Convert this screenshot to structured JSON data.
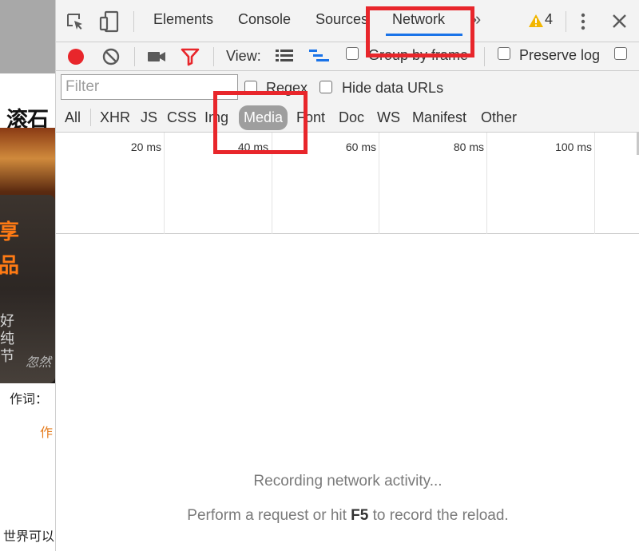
{
  "webpage": {
    "logo_text": "滚石",
    "art_orange_lines": [
      "享",
      "品"
    ],
    "art_gray_lines": [
      "好",
      "纯",
      "节"
    ],
    "art_small_text": "忽然",
    "lyric_1": "作词：",
    "lyric_2": "作",
    "lyric_3": "世界可以"
  },
  "devtools": {
    "tabs": {
      "elements": "Elements",
      "console": "Console",
      "sources": "Sources",
      "network": "Network"
    },
    "overflow_icon": "»",
    "warning_count": "4",
    "icons": {
      "inspect": "inspect-element-icon",
      "device": "device-toolbar-icon",
      "warning": "warning-icon",
      "more": "more-vertical-icon",
      "close": "close-icon",
      "record": "record-icon",
      "clear": "clear-icon",
      "capture": "screenshot-camera-icon",
      "filter": "filter-icon",
      "large_rows": "large-rows-icon",
      "waterfall": "waterfall-icon"
    },
    "toolbar": {
      "view_label": "View:",
      "group_by_frame": "Group by frame",
      "preserve_log": "Preserve log"
    },
    "filter": {
      "placeholder": "Filter",
      "value": "",
      "regex": "Regex",
      "hide_data_urls": "Hide data URLs"
    },
    "types": [
      "All",
      "XHR",
      "JS",
      "CSS",
      "Img",
      "Media",
      "Font",
      "Doc",
      "WS",
      "Manifest",
      "Other"
    ],
    "active_type": "Media",
    "timeline_labels": [
      "20 ms",
      "40 ms",
      "60 ms",
      "80 ms",
      "100 ms"
    ],
    "empty_state": {
      "line1": "Recording network activity...",
      "line2_before": "Perform a request or hit ",
      "line2_key": "F5",
      "line2_after": " to record the reload."
    },
    "colors": {
      "record_red": "#e8262b",
      "highlight_red": "#e8262b",
      "active_tab_underline": "#1a73e8",
      "active_type_pill": "#9e9e9e",
      "warning_yellow": "#f2b600"
    }
  }
}
